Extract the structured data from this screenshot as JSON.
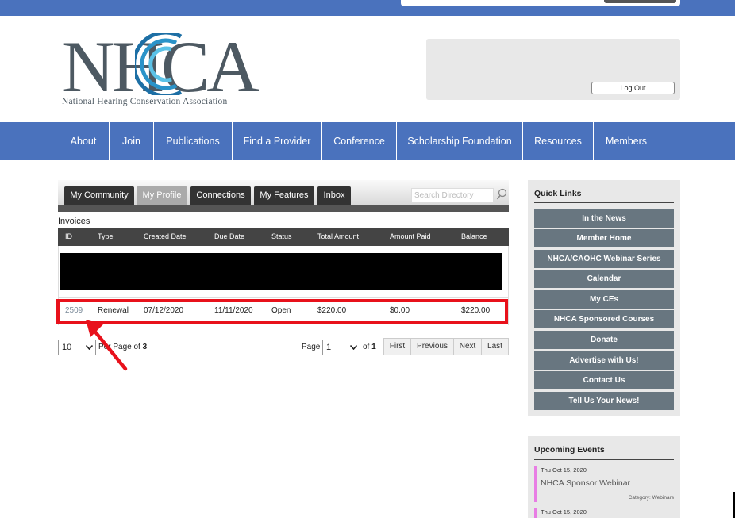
{
  "header": {
    "logo": {
      "letters": "NHCA",
      "tagline": "National Hearing Conservation Association"
    },
    "logout_label": "Log Out"
  },
  "nav": {
    "items": [
      "About",
      "Join",
      "Publications",
      "Find a Provider",
      "Conference",
      "Scholarship Foundation",
      "Resources",
      "Members"
    ]
  },
  "tabs": {
    "items": [
      "My Community",
      "My Profile",
      "Connections",
      "My Features",
      "Inbox"
    ],
    "active": "My Profile",
    "search_placeholder": "Search Directory"
  },
  "invoices": {
    "title": "Invoices",
    "columns": [
      "ID",
      "Type",
      "Created Date",
      "Due Date",
      "Status",
      "Total Amount",
      "Amount Paid",
      "Balance"
    ],
    "row": {
      "id": "2509",
      "type": "Renewal",
      "created": "07/12/2020",
      "due": "11/11/2020",
      "status": "Open",
      "total": "$220.00",
      "paid": "$0.00",
      "balance": "$220.00"
    }
  },
  "pagination": {
    "per_page_value": "10",
    "per_page_label_prefix": "Per Page of",
    "per_page_total": "3",
    "page_label": "Page",
    "page_value": "1",
    "of_label": "of",
    "of_total": "1",
    "buttons": [
      "First",
      "Previous",
      "Next",
      "Last"
    ]
  },
  "quick_links": {
    "title": "Quick Links",
    "items": [
      "In the News",
      "Member Home",
      "NHCA/CAOHC Webinar Series",
      "Calendar",
      "My CEs",
      "NHCA Sponsored Courses",
      "Donate",
      "Advertise with Us!",
      "Contact Us",
      "Tell Us Your News!"
    ]
  },
  "events": {
    "title": "Upcoming Events",
    "items": [
      {
        "date": "Thu Oct 15, 2020",
        "name": "NHCA Sponsor Webinar",
        "category": "Category: Webinars"
      },
      {
        "date": "Thu Oct 15, 2020"
      }
    ]
  },
  "colors": {
    "brand_blue": "#4a72bd",
    "highlight_red": "#e8111b",
    "quicklink_bg": "#687680",
    "event_bar": "#e87de4"
  }
}
